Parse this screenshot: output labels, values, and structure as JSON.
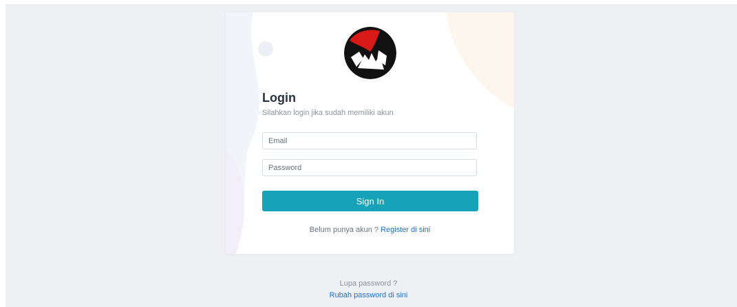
{
  "login": {
    "title": "Login",
    "subtitle": "Silahkan login jika sudah memiliki akun",
    "email_placeholder": "Email",
    "password_placeholder": "Password",
    "signin_label": "Sign In",
    "register_prompt": "Belum punya akun ?",
    "register_link": "Register di sini"
  },
  "footer": {
    "forgot_prompt": "Lupa password ?",
    "reset_link": "Rubah password di sini"
  },
  "colors": {
    "page_bg": "#eef0f4",
    "primary": "#16a2b8",
    "link": "#1f6fd1"
  },
  "icons": {
    "logo": "hands-logo-icon"
  }
}
